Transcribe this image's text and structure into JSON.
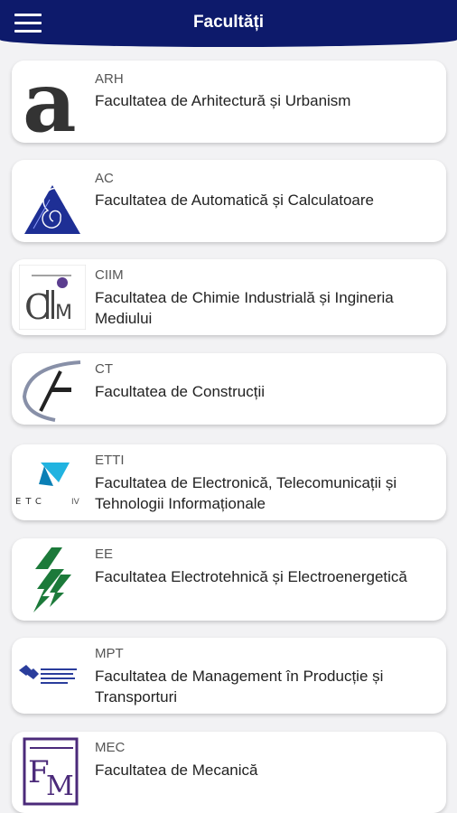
{
  "header": {
    "title": "Facultăți",
    "menu_icon": "hamburger-menu-icon"
  },
  "faculties": [
    {
      "abbr": "ARH",
      "name": "Facultatea de Arhitectură și Urbanism",
      "logo": "letter-a-logo"
    },
    {
      "abbr": "AC",
      "name": "Facultatea de Automatică și Calculatoare",
      "logo": "blue-triangle-spiral-logo"
    },
    {
      "abbr": "CIIM",
      "name": "Facultatea de Chimie Industrială și Ingineria Mediului",
      "logo": "flask-ciim-logo"
    },
    {
      "abbr": "CT",
      "name": "Facultatea de Construcții",
      "logo": "arc-slash-logo"
    },
    {
      "abbr": "ETTI",
      "name": "Facultatea de Electronică, Telecomunicații și Tehnologii Informaționale",
      "logo": "etti-logo"
    },
    {
      "abbr": "EE",
      "name": "Facultatea Electrotehnică și Electroenergetică",
      "logo": "green-lightning-logo"
    },
    {
      "abbr": "MPT",
      "name": "Facultatea de Management în Producție și Transporturi",
      "logo": "mpt-logo"
    },
    {
      "abbr": "MEC",
      "name": "Facultatea de Mecanică",
      "logo": "fm-logo"
    }
  ],
  "colors": {
    "header": "#0d1a6b",
    "background": "#f2f2f4",
    "card": "#ffffff"
  }
}
